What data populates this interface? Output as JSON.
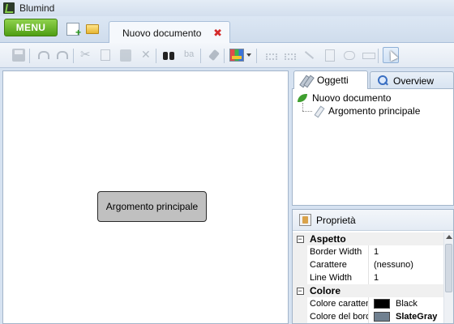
{
  "window": {
    "title": "Blumind"
  },
  "menu": {
    "label": "MENU"
  },
  "document_tab": {
    "label": "Nuovo documento",
    "close_glyph": "✖"
  },
  "toolbar": {
    "icons": [
      "save-icon",
      "undo-icon",
      "redo-icon",
      "cut-icon",
      "copy-icon",
      "paste-icon",
      "delete-icon",
      "find-icon",
      "replace-icon",
      "format-brush-icon",
      "layout-icon",
      "topic-tool-icon",
      "link-tool-icon",
      "line-tool-icon",
      "note-tool-icon",
      "callout-tool-icon",
      "label-tool-icon",
      "pointer-icon"
    ]
  },
  "canvas": {
    "node_label": "Argomento principale"
  },
  "objects_panel": {
    "tabs": [
      {
        "label": "Oggetti",
        "active": true
      },
      {
        "label": "Overview",
        "active": false
      }
    ],
    "tree": {
      "root": "Nuovo documento",
      "children": [
        "Argomento principale"
      ]
    }
  },
  "properties": {
    "title": "Proprietà",
    "categories": [
      {
        "name": "Aspetto",
        "toggle": "−",
        "rows": [
          {
            "name": "Border Width",
            "value": "1"
          },
          {
            "name": "Carattere",
            "value": "(nessuno)"
          },
          {
            "name": "Line Width",
            "value": "1"
          }
        ]
      },
      {
        "name": "Colore",
        "toggle": "−",
        "rows": [
          {
            "name": "Colore caratten",
            "value": "Black",
            "swatch": "#000000"
          },
          {
            "name": "Colore del bord",
            "value": "SlateGray",
            "swatch": "#708090",
            "bold": true
          }
        ]
      }
    ]
  },
  "colors": {
    "menu_green": "#5aa81c",
    "node_fill": "#c0c0c0",
    "frame_blue": "#d6e2f1",
    "close_red": "#d42a2a"
  }
}
